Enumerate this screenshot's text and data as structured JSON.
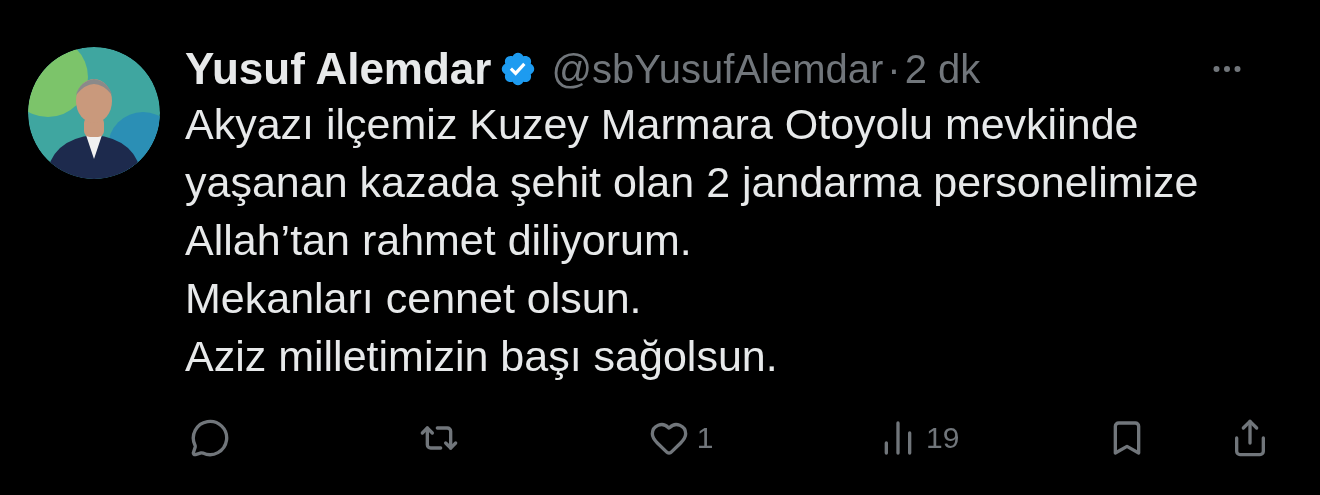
{
  "author": {
    "name": "Yusuf Alemdar",
    "verified": true,
    "handle": "@sbYusufAlemdar",
    "separator": "·",
    "time": "2 dk"
  },
  "avatar": {
    "kind": "picture"
  },
  "text_lines": [
    "Akyazı ilçemiz Kuzey Marmara Otoyolu mevkiinde",
    "yaşanan kazada şehit olan 2 jandarma personelimize",
    "Allah’tan rahmet diliyorum.",
    "Mekanları cennet olsun.",
    "Aziz milletimizin başı sağolsun."
  ],
  "actions": [
    {
      "kind": "reply"
    },
    {
      "kind": "retweet"
    },
    {
      "kind": "like",
      "count": "1"
    },
    {
      "kind": "views",
      "count": "19"
    },
    {
      "kind": "bookmark"
    },
    {
      "kind": "share"
    }
  ]
}
